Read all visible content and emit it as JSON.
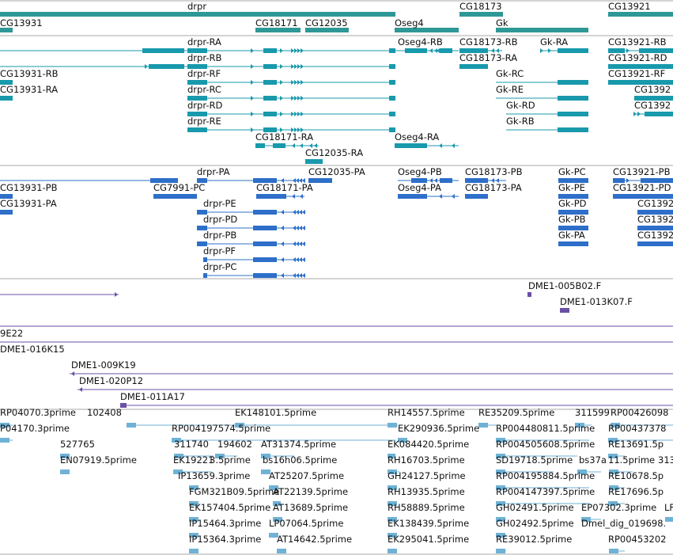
{
  "tracks": {
    "colors": {
      "gene": "#2e9896",
      "transcript_a": "#1899ac",
      "transcript_b": "#2d6fc9",
      "clone": "#6a50a6",
      "est": "#6fb2d6",
      "separator": "#aaaaaa"
    },
    "gene_labels": [
      "drpr",
      "CG18173",
      "CG13921",
      "CG13931",
      "CG18171",
      "CG12035",
      "Oseg4",
      "Gk"
    ],
    "transcripts_r": [
      "drpr-RA",
      "drpr-RB",
      "drpr-RF",
      "drpr-RC",
      "drpr-RD",
      "drpr-RE",
      "Oseg4-RB",
      "CG18173-RB",
      "CG18173-RA",
      "Gk-RA",
      "Gk-RC",
      "Gk-RE",
      "Gk-RD",
      "Gk-RB",
      "CG13921-RB",
      "CG13921-RD",
      "CG13921-RF",
      "CG1392",
      "CG1392",
      "CG13931-RB",
      "CG13931-RA",
      "CG18171-RA",
      "Oseg4-RA",
      "CG12035-RA"
    ],
    "transcripts_p": [
      "drpr-PA",
      "CG12035-PA",
      "Oseg4-PB",
      "CG18173-PB",
      "Gk-PC",
      "CG13921-PB",
      "CG13931-PB",
      "CG7991-PC",
      "CG18171-PA",
      "Oseg4-PA",
      "CG18173-PA",
      "Gk-PE",
      "CG13921-PD",
      "drpr-PE",
      "Gk-PD",
      "CG1392",
      "drpr-PD",
      "Gk-PB",
      "CG1392",
      "drpr-PB",
      "Gk-PA",
      "CG1392",
      "drpr-PF",
      "drpr-PC",
      "CG13931-PA"
    ],
    "clones": [
      "DME1-005B02.F",
      "DME1-013K07.F",
      "9E22",
      "DME1-016K15",
      "DME1-009K19",
      "DME1-020P12",
      "DME1-011A17"
    ],
    "ests": [
      "RP04070.3prime",
      "102408",
      "EK148101.5prime",
      "RH14557.5prime",
      "RE35209.5prime",
      "311599",
      "RP00426098",
      "P04170.3prime",
      "RP004197574.5prime",
      "EK290936.5prime",
      "RP004480811.5prime",
      "RP00437378",
      "527765",
      "311740",
      "194602",
      "AT31374.5prime",
      "EK084420.5prime",
      "RP004505608.5prime",
      "RE13691.5p",
      "EN07919.5prime",
      "EK19221",
      "3.5prime",
      "bs16h06.5prime",
      "RH16703.5prime",
      "SD19718.5prime",
      "bs37a",
      "11.5prime",
      "313",
      "IP13659.3prime",
      "AT25207.5prime",
      "GH24127.5prime",
      "RP004195884.5prime",
      "RE10678.5p",
      "FGM321B09.5prime",
      "AT22139.5prime",
      "RH13935.5prime",
      "RP004147397.5prime",
      "RE17696.5p",
      "EK157404.5prime",
      "AT13689.5prime",
      "RH58889.5prime",
      "GH02491.5prime",
      "EP07302.3prime",
      "LF",
      "IP15464.3prime",
      "LP07064.5prime",
      "EK138439.5prime",
      "GH02492.5prime",
      "Dmel_dig_019698.",
      "IP15364.3prime",
      "AT14642.5prime",
      "EK295041.5prime",
      "RE39012.5prime",
      "RP00453202"
    ]
  }
}
